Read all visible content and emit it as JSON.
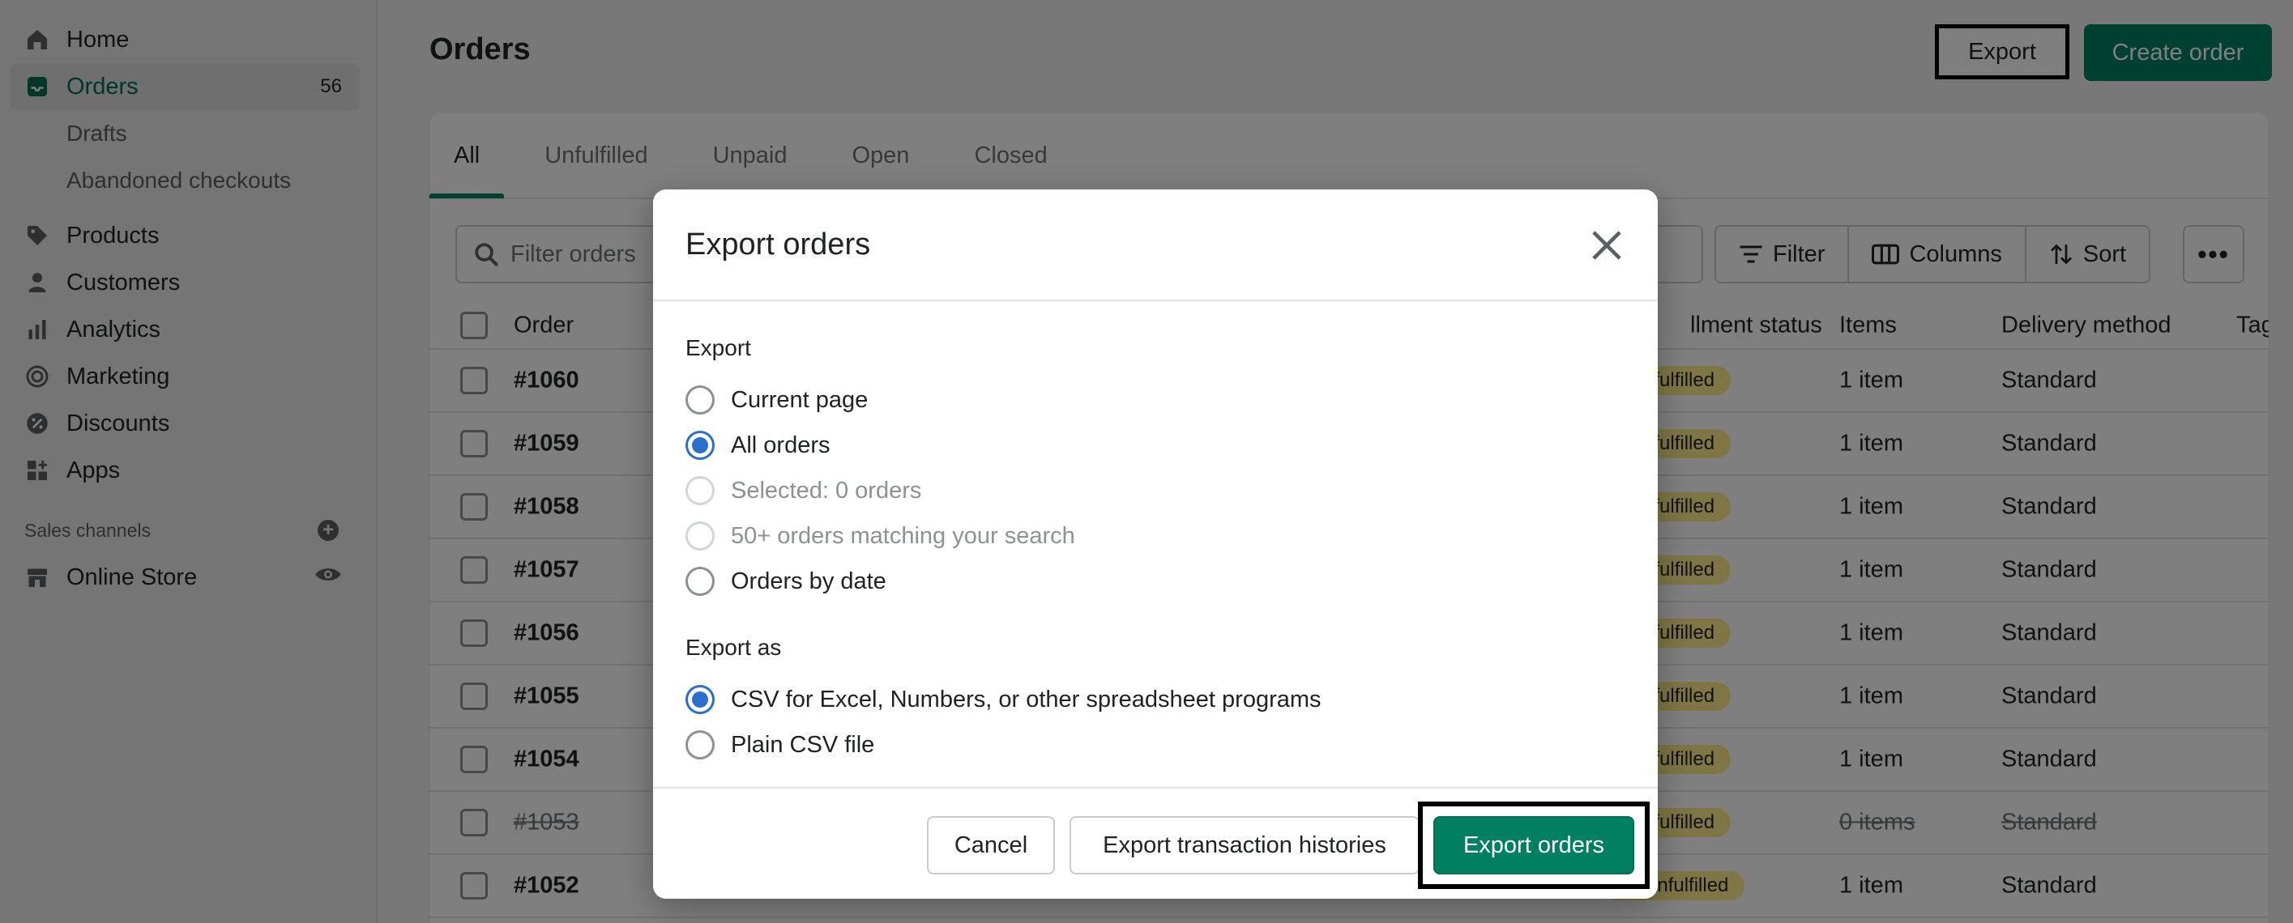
{
  "sidebar": {
    "items": [
      {
        "label": "Home",
        "icon": "home-icon"
      },
      {
        "label": "Orders",
        "icon": "orders-icon",
        "count": "56"
      },
      {
        "label": "Drafts"
      },
      {
        "label": "Abandoned checkouts"
      },
      {
        "label": "Products",
        "icon": "tag-icon"
      },
      {
        "label": "Customers",
        "icon": "person-icon"
      },
      {
        "label": "Analytics",
        "icon": "bar-chart-icon"
      },
      {
        "label": "Marketing",
        "icon": "target-icon"
      },
      {
        "label": "Discounts",
        "icon": "discount-icon"
      },
      {
        "label": "Apps",
        "icon": "apps-icon"
      }
    ],
    "sales_channels_label": "Sales channels",
    "online_store_label": "Online Store"
  },
  "header": {
    "title": "Orders",
    "export_label": "Export",
    "create_label": "Create order"
  },
  "tabs": [
    "All",
    "Unfulfilled",
    "Unpaid",
    "Open",
    "Closed"
  ],
  "toolbar": {
    "search_placeholder": "Filter orders",
    "filter_label": "Filter",
    "columns_label": "Columns",
    "sort_label": "Sort",
    "more_label": "•••"
  },
  "table": {
    "headers": {
      "order": "Order",
      "fulfillment": "llment status",
      "items": "Items",
      "delivery": "Delivery method",
      "tags": "Tag"
    },
    "rows": [
      {
        "order": "#1060",
        "fulfillment": "nfulfilled",
        "items": "1 item",
        "delivery": "Standard",
        "cancelled": false
      },
      {
        "order": "#1059",
        "fulfillment": "nfulfilled",
        "items": "1 item",
        "delivery": "Standard",
        "cancelled": false
      },
      {
        "order": "#1058",
        "fulfillment": "nfulfilled",
        "items": "1 item",
        "delivery": "Standard",
        "cancelled": false
      },
      {
        "order": "#1057",
        "fulfillment": "nfulfilled",
        "items": "1 item",
        "delivery": "Standard",
        "cancelled": false
      },
      {
        "order": "#1056",
        "fulfillment": "nfulfilled",
        "items": "1 item",
        "delivery": "Standard",
        "cancelled": false
      },
      {
        "order": "#1055",
        "fulfillment": "nfulfilled",
        "items": "1 item",
        "delivery": "Standard",
        "cancelled": false
      },
      {
        "order": "#1054",
        "fulfillment": "nfulfilled",
        "items": "1 item",
        "delivery": "Standard",
        "cancelled": false
      },
      {
        "order": "#1053",
        "fulfillment": "nfulfilled",
        "items": "0 items",
        "delivery": "Standard",
        "cancelled": true
      },
      {
        "order": "#1052",
        "fulfillment": "Unfulfilled",
        "items": "1 item",
        "delivery": "Standard",
        "cancelled": false
      }
    ]
  },
  "modal": {
    "title": "Export orders",
    "export_label": "Export",
    "export_options": [
      {
        "label": "Current page",
        "checked": false,
        "disabled": false
      },
      {
        "label": "All orders",
        "checked": true,
        "disabled": false
      },
      {
        "label": "Selected: 0 orders",
        "checked": false,
        "disabled": true
      },
      {
        "label": "50+ orders matching your search",
        "checked": false,
        "disabled": true
      },
      {
        "label": "Orders by date",
        "checked": false,
        "disabled": false
      }
    ],
    "export_as_label": "Export as",
    "format_options": [
      {
        "label": "CSV for Excel, Numbers, or other spreadsheet programs",
        "checked": true
      },
      {
        "label": "Plain CSV file",
        "checked": false
      }
    ],
    "cancel_label": "Cancel",
    "transactions_label": "Export transaction histories",
    "export_orders_label": "Export orders"
  },
  "colors": {
    "primary_green": "#008060",
    "radio_blue": "#2c6ecb",
    "badge_yellow": "#ffea8a",
    "active_nav_text": "#006e52"
  }
}
